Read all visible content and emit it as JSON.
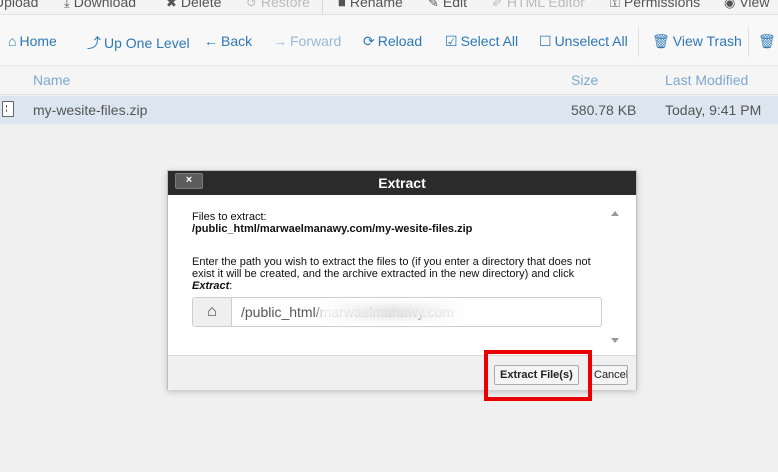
{
  "toolbar_top": {
    "items": [
      {
        "icon": "upload-icon",
        "label": "Upload"
      },
      {
        "icon": "download-icon",
        "label": "Download"
      },
      {
        "icon": "delete-icon",
        "label": "Delete"
      },
      {
        "icon": "restore-icon",
        "label": "Restore"
      },
      {
        "icon": "rename-icon",
        "label": "Rename"
      },
      {
        "icon": "edit-icon",
        "label": "Edit"
      },
      {
        "icon": "html-editor-icon",
        "label": "HTML Editor"
      },
      {
        "icon": "permissions-icon",
        "label": "Permissions"
      },
      {
        "icon": "view-icon",
        "label": "View"
      }
    ]
  },
  "toolbar_nav": {
    "items": [
      {
        "icon": "home-icon",
        "label": "Home"
      },
      {
        "icon": "up-level-icon",
        "label": "Up One Level"
      },
      {
        "icon": "back-icon",
        "label": "Back"
      },
      {
        "icon": "forward-icon",
        "label": "Forward"
      },
      {
        "icon": "reload-icon",
        "label": "Reload"
      },
      {
        "icon": "select-all-icon",
        "label": "Select All"
      },
      {
        "icon": "unselect-all-icon",
        "label": "Unselect All"
      },
      {
        "icon": "trash-icon",
        "label": "View Trash"
      }
    ]
  },
  "file_list": {
    "columns": {
      "name": "Name",
      "size": "Size",
      "modified": "Last Modified"
    },
    "rows": [
      {
        "name": "my-wesite-files.zip",
        "size": "580.78 KB",
        "modified": "Today, 9:41 PM"
      }
    ]
  },
  "dialog": {
    "title": "Extract",
    "close_label": "×",
    "files_to_extract_label": "Files to extract:",
    "file_path": "/public_html/marwaelmanawy.com/my-wesite-files.zip",
    "instruction": "Enter the path you wish to extract the files to (if you enter a directory that does not exist it will be created, and the archive extracted in the new directory) and click",
    "instruction_action": "Extract",
    "instruction_end": ":",
    "destination_value": "/public_html/marwaelmanawy.com",
    "extract_button": "Extract File(s)",
    "cancel_button": "Cancel"
  },
  "colors": {
    "link": "#2f77b5",
    "header_dark": "#2b2b2b",
    "selected_row": "#dbe6f1",
    "highlight": "#ea0000"
  }
}
